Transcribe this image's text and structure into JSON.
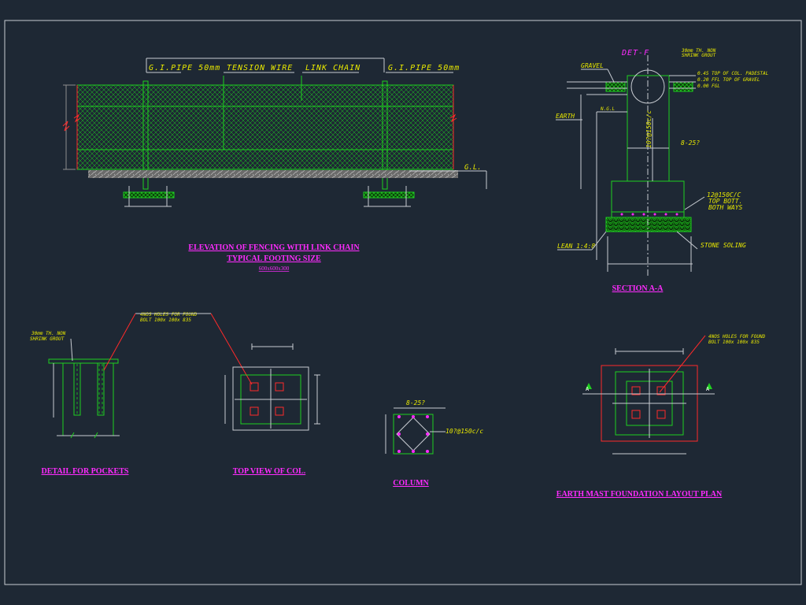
{
  "colors": {
    "background": "#1e2834",
    "frame": "#c8ccd2",
    "green": "#1fd01f",
    "yellow": "#e8e800",
    "magenta": "#ff2bff",
    "red": "#ff2a2a",
    "white": "#ffffff",
    "gray": "#8e8e8e",
    "cyan": "#00e5ff"
  },
  "icons": {
    "section_marker": "section-arrow-icon",
    "hatch": "crosshatch-pattern"
  },
  "elevation": {
    "label_pipe_left": "G.I.PIPE 50mm",
    "label_tension": "TENSION WIRE",
    "label_chain": "LINK CHAIN",
    "label_pipe_right": "G.I.PIPE 50mm",
    "label_gl": "G.L.",
    "title": "ELEVATION OF FENCING WITH LINK CHAIN",
    "subtitle": "TYPICAL FOOTING SIZE",
    "size": "600x600x300"
  },
  "section": {
    "det": "DET-F",
    "grout": "30mm TH. NON\nSHRINK GROUT",
    "gravel": "GRAVEL",
    "level1": "0.45 TOP OF COL. PADESTAL",
    "level2": "0.20 FFL TOP OF GRAVEL",
    "level3": "0.00 FGL",
    "earth": "EARTH",
    "ngl": "N.G.L",
    "rebar": "10?@150c/c",
    "bars": "8-25?",
    "mesh_l1": "12@150C/C",
    "mesh_l2": "TOP BOTT.",
    "mesh_l3": "BOTH WAYS",
    "lean": "LEAN 1:4:8",
    "stone": "STONE SOLING",
    "title": "SECTION A-A"
  },
  "pockets": {
    "grout_l1": "30mm TH. NON",
    "grout_l2": "SHRINK GROUT",
    "holes_l1": "4NOS HOLES FOR FOUND",
    "holes_l2": "BOLT 100x 100x 835",
    "title": "DETAIL FOR POCKETS"
  },
  "topview": {
    "title": "TOP VIEW OF COL."
  },
  "column": {
    "bars": "8-25?",
    "rebar": "10?@150c/c",
    "title": "COLUMN"
  },
  "earthmast": {
    "holes_l1": "4NOS HOLES FOR FOUND",
    "holes_l2": "BOLT 100x 100x 835",
    "marker": "A",
    "title": "EARTH MAST  FOUNDATION LAYOUT PLAN"
  }
}
